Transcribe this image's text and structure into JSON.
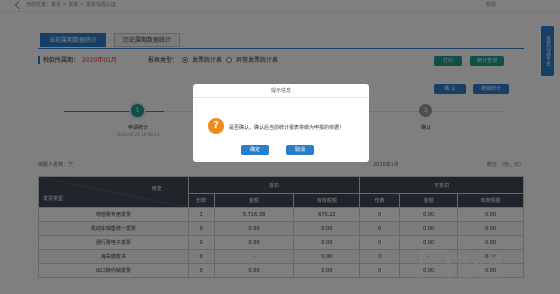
{
  "header": {
    "breadcrumb": "当前位置：首页 > 发票 > 发票勾选认证",
    "help": "帮助"
  },
  "tabs": [
    {
      "label": "当前属期数据统计",
      "active": true
    },
    {
      "label": "历史属期数据统计",
      "active": false
    }
  ],
  "period": {
    "label": "税款所属期：",
    "value": "2020年01月"
  },
  "report_type": {
    "label": "报表类型：",
    "options": [
      "发票统计表",
      "异常发票统计表"
    ],
    "selected": 0
  },
  "actions": {
    "print": "打印",
    "query": "统计查询",
    "confirm": "确 认",
    "cancel_stats": "撤销统计"
  },
  "side_tab": "发票勾选平台",
  "steps": [
    {
      "number": "1",
      "label": "申请统计",
      "date": "2020-02-21 10:08:23"
    },
    {
      "number": "3",
      "label": "确认",
      "date": ""
    }
  ],
  "info": {
    "taxpayer": "纳税人名称：宁",
    "period": "：2020年1月",
    "unit": "单位：（份，元）"
  },
  "table": {
    "corner_top": "用途",
    "corner_bottom": "发票类型",
    "group_deduct": "抵扣",
    "group_nondeduct": "不抵扣",
    "sub_headers": [
      "份数",
      "金额",
      "有效税额",
      "份数",
      "金额",
      "有效税额"
    ],
    "rows": [
      {
        "type": "增值税专用发票",
        "cells": [
          "1",
          "5,716.38",
          "670.22",
          "0",
          "0.00",
          "0.00"
        ]
      },
      {
        "type": "机动车销售统一发票",
        "cells": [
          "0",
          "0.00",
          "0.00",
          "0",
          "0.00",
          "0.00"
        ]
      },
      {
        "type": "通行费电子发票",
        "cells": [
          "0",
          "0.00",
          "0.00",
          "0",
          "0.00",
          "0.00"
        ]
      },
      {
        "type": "海关缴款书",
        "cells": [
          "0",
          "-",
          "0.00",
          "0",
          "-",
          "0.00"
        ]
      },
      {
        "type": "出口转内销发票",
        "cells": [
          "0",
          "0.00",
          "0.00",
          "0",
          "0.00",
          "0.00"
        ]
      }
    ]
  },
  "dialog": {
    "title": "提示信息",
    "icon": "question-icon",
    "message": "是否确认，确认后当前统计报表将做为申报的依据！",
    "ok": "确定",
    "cancel": "取消"
  },
  "watermark": {
    "line1": "会计网",
    "line2": "kuaiji.com"
  },
  "colors": {
    "primary": "#2a7fc9",
    "teal": "#1e9e8f",
    "header_dark": "#3f4a56",
    "warning": "#f08a1c",
    "period_red": "#d9342b"
  }
}
